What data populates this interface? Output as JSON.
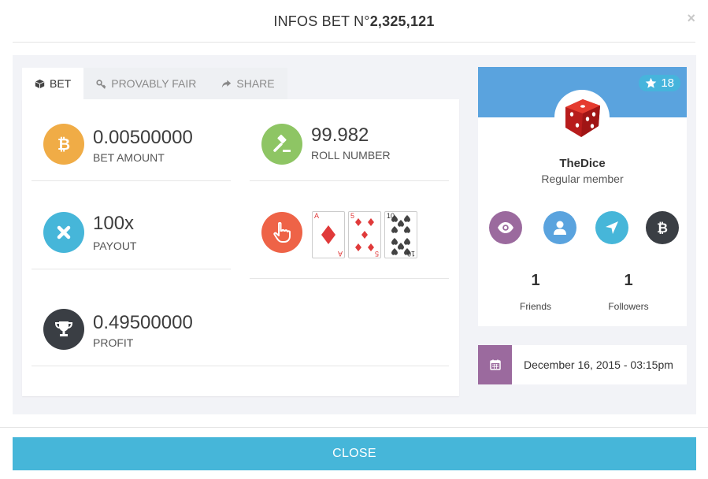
{
  "header": {
    "title_prefix": "INFOS BET N°",
    "bet_number": "2,325,121",
    "close_symbol": "×"
  },
  "tabs": [
    {
      "label": "BET",
      "icon": "cube-icon",
      "active": true
    },
    {
      "label": "PROVABLY FAIR",
      "icon": "key-icon",
      "active": false
    },
    {
      "label": "SHARE",
      "icon": "share-icon",
      "active": false
    }
  ],
  "stats": {
    "bet_amount": {
      "value": "0.00500000",
      "label": "BET AMOUNT",
      "icon": "bitcoin-icon",
      "color": "#f0ac46"
    },
    "roll_number": {
      "value": "99.982",
      "label": "ROLL NUMBER",
      "icon": "gavel-icon",
      "color": "#8ec564"
    },
    "payout": {
      "value": "100x",
      "label": "PAYOUT",
      "icon": "times-icon",
      "color": "#46b6d9"
    },
    "cards": {
      "icon": "pointer-hand-icon",
      "color": "#ee6347"
    },
    "profit": {
      "value": "0.49500000",
      "label": "PROFIT",
      "icon": "trophy-icon",
      "color": "#3a3e44"
    }
  },
  "playing_cards": [
    {
      "rank": "A",
      "suit": "♦",
      "color": "#e03a3a"
    },
    {
      "rank": "5",
      "suit": "♦",
      "color": "#e03a3a"
    },
    {
      "rank": "10",
      "suit": "♠",
      "color": "#333333"
    }
  ],
  "profile": {
    "stars": "18",
    "username": "TheDice",
    "role": "Regular member",
    "banner_color": "#5aa3de",
    "actions": [
      {
        "icon": "eye-icon",
        "color": "#9b6a9e"
      },
      {
        "icon": "user-icon",
        "color": "#5aa3de"
      },
      {
        "icon": "location-arrow-icon",
        "color": "#46b6d9"
      },
      {
        "icon": "bitcoin-icon",
        "color": "#3a3e44"
      }
    ],
    "friends": {
      "count": "1",
      "label": "Friends"
    },
    "followers": {
      "count": "1",
      "label": "Followers"
    }
  },
  "date": {
    "text": "December 16, 2015 - 03:15pm",
    "icon": "calendar-icon",
    "color": "#9b6a9e"
  },
  "footer": {
    "close_label": "CLOSE",
    "color": "#46b6d9"
  }
}
